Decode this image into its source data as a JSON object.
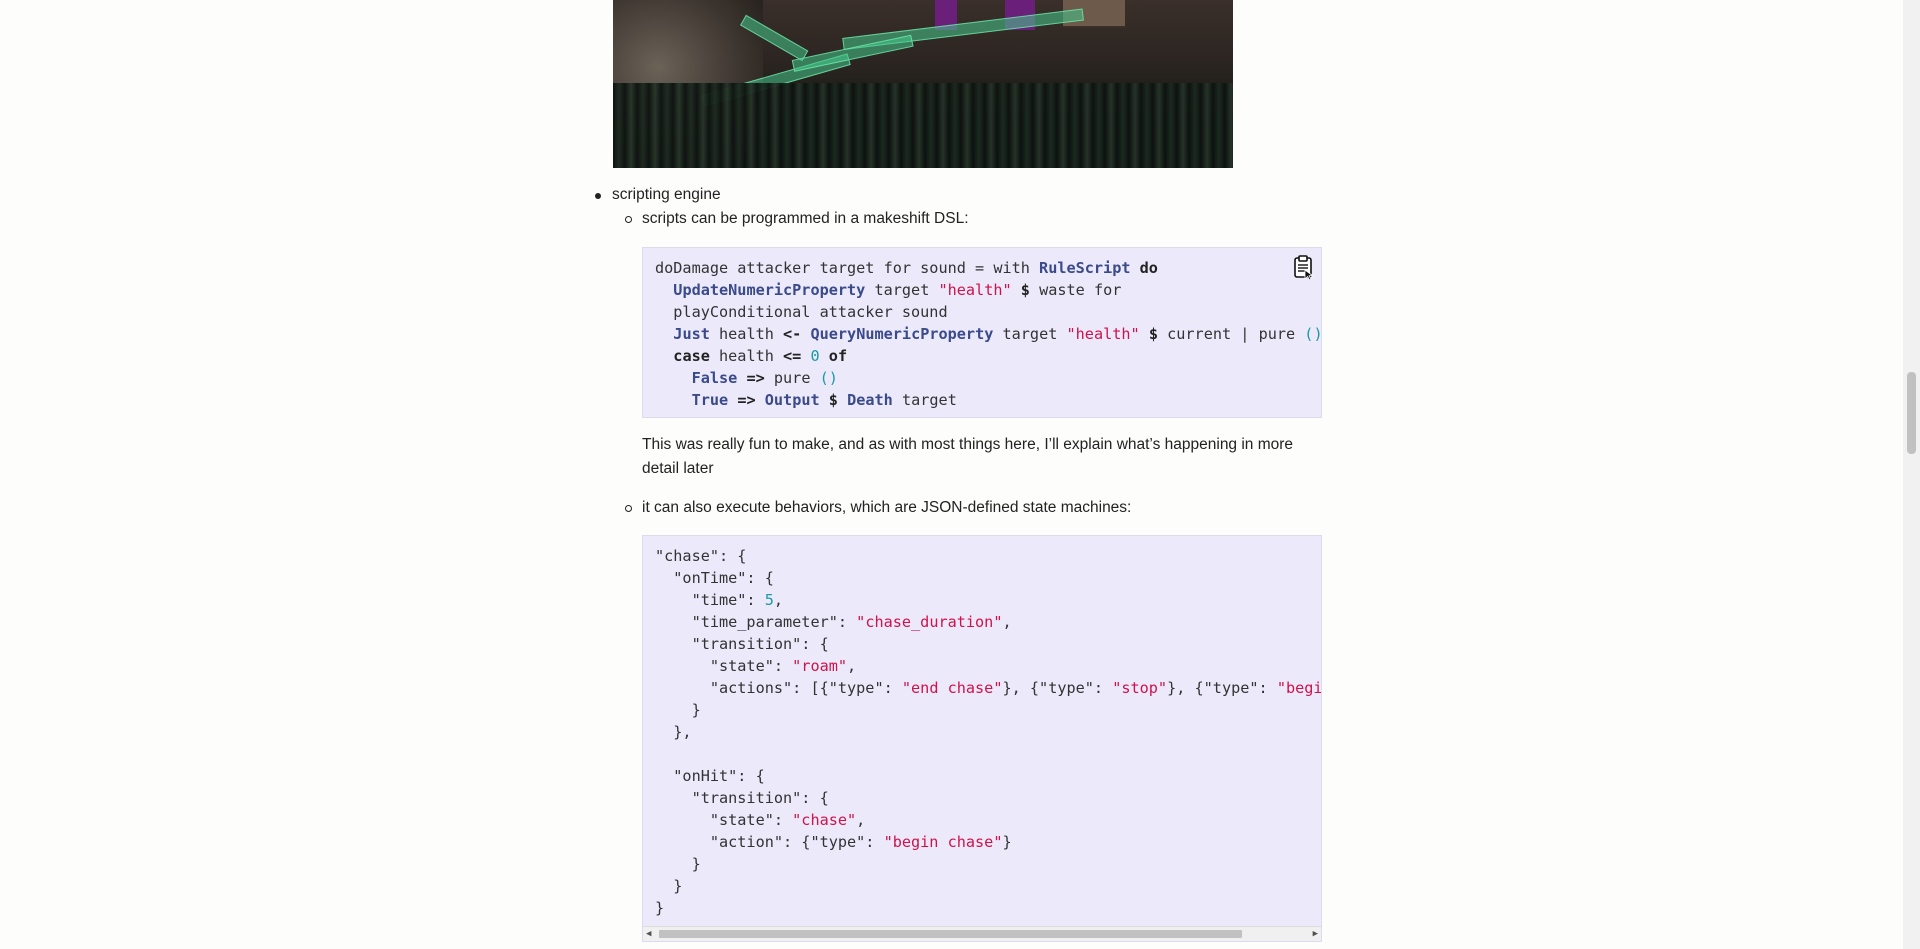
{
  "game_image": {
    "alt": "game screenshot"
  },
  "list": {
    "item_scripting": "scripting engine",
    "sub_dsl": "scripts can be programmed in a makeshift DSL:",
    "sub_behaviors": "it can also execute behaviors, which are JSON-defined state machines:"
  },
  "paragraph": {
    "line1": "This was really fun to make, and as with most things here, I’ll explain what’s happening in more",
    "line2": "detail later"
  },
  "code_dsl": {
    "lines": [
      "doDamage attacker target for sound = with RuleScript do",
      "  UpdateNumericProperty target \"health\" $ waste for",
      "  playConditional attacker sound",
      "  Just health <- QueryNumericProperty target \"health\" $ current | pure ()",
      "  case health <= 0 of",
      "    False => pure ()",
      "    True => Output $ Death target"
    ]
  },
  "code_json": {
    "lines": [
      "\"chase\": {",
      "  \"onTime\": {",
      "    \"time\": 5,",
      "    \"time_parameter\": \"chase_duration\",",
      "    \"transition\": {",
      "      \"state\": \"roam\",",
      "      \"actions\": [{\"type\": \"end chase\"}, {\"type\": \"stop\"}, {\"type\": \"begin",
      "    }",
      "  },",
      "",
      "  \"onHit\": {",
      "    \"transition\": {",
      "      \"state\": \"chase\",",
      "      \"action\": {\"type\": \"begin chase\"}",
      "    }",
      "  }",
      "}"
    ]
  },
  "icons": {
    "copy": "clipboard-icon",
    "scroll_left": "◀",
    "scroll_right": "▶"
  },
  "colors": {
    "code_bg": "#ebe9fa",
    "string": "#d0124a",
    "number": "#1a9aa3",
    "type": "#3a4a8a"
  }
}
